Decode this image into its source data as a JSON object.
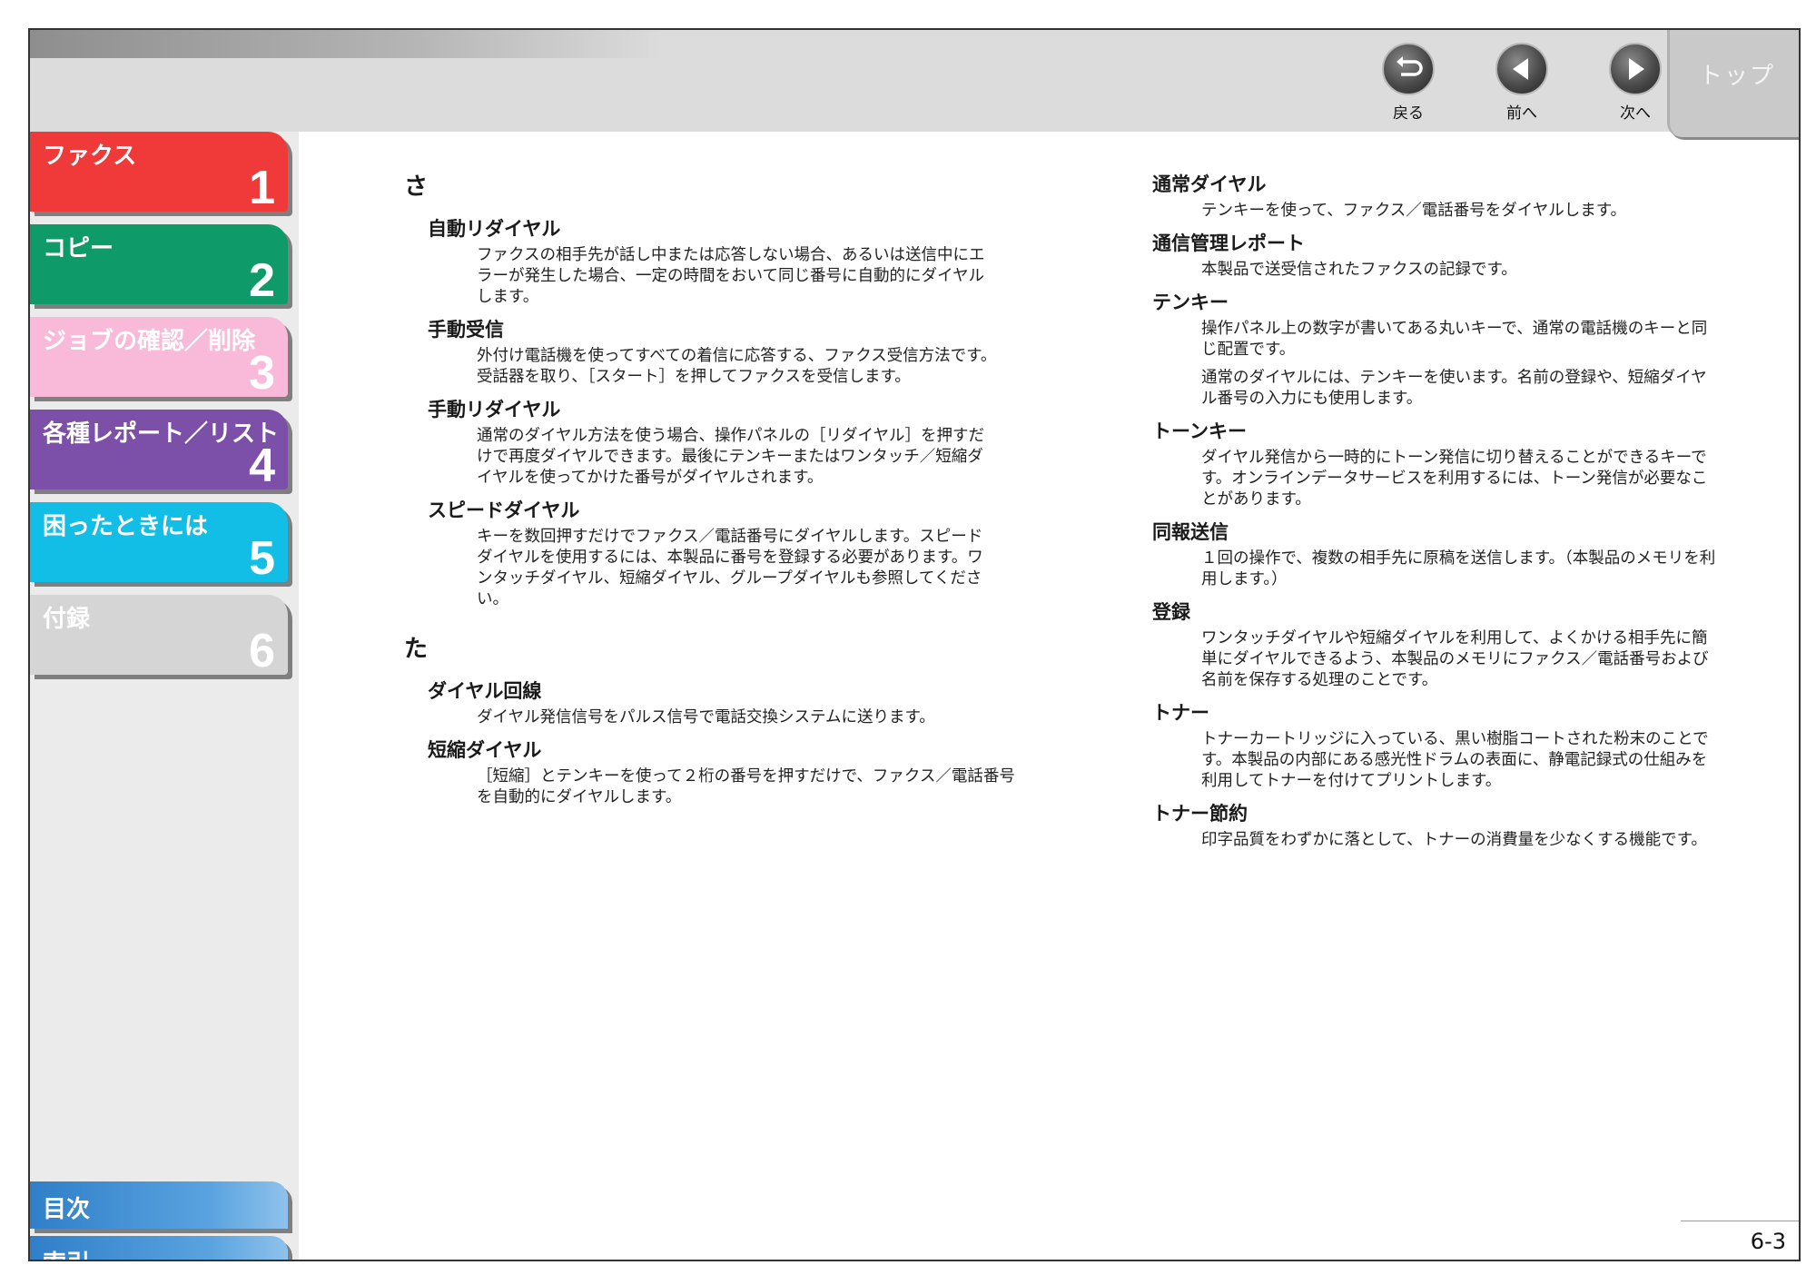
{
  "nav": {
    "back_label": "戻る",
    "prev_label": "前へ",
    "next_label": "次へ",
    "top_label": "トップ"
  },
  "sidebar": {
    "tabs": [
      {
        "label": "ファクス",
        "number": "1",
        "color": "#f03a3a"
      },
      {
        "label": "コピー",
        "number": "2",
        "color": "#0f9a6a"
      },
      {
        "label": "ジョブの確認／削除",
        "number": "3",
        "color": "#f9b9d8"
      },
      {
        "label": "各種レポート／リスト",
        "number": "4",
        "color": "#7c4fa9"
      },
      {
        "label": "困ったときには",
        "number": "5",
        "color": "#12bde6"
      },
      {
        "label": "付録",
        "number": "6",
        "color": "#d5d5d5"
      }
    ],
    "links": [
      {
        "label": "目次"
      },
      {
        "label": "索引"
      }
    ]
  },
  "left": {
    "sa": {
      "heading": "さ",
      "items": [
        {
          "term": "自動リダイヤル",
          "desc": [
            "ファクスの相手先が話し中または応答しない場合、あるいは送信中にエ",
            "ラーが発生した場合、一定の時間をおいて同じ番号に自動的にダイヤル",
            "します。"
          ]
        },
        {
          "term": "手動受信",
          "desc": [
            "外付け電話機を使ってすべての着信に応答する、ファクス受信方法です。",
            "受話器を取り、［スタート］を押してファクスを受信します。"
          ]
        },
        {
          "term": "手動リダイヤル",
          "desc": [
            "通常のダイヤル方法を使う場合、操作パネルの［リダイヤル］を押すだ",
            "けで再度ダイヤルできます。最後にテンキーまたはワンタッチ／短縮ダ",
            "イヤルを使ってかけた番号がダイヤルされます。"
          ]
        },
        {
          "term": "スピードダイヤル",
          "desc": [
            "キーを数回押すだけでファクス／電話番号にダイヤルします。スピード",
            "ダイヤルを使用するには、本製品に番号を登録する必要があります。ワ",
            "ンタッチダイヤル、短縮ダイヤル、グループダイヤルも参照してくださ",
            "い。"
          ]
        }
      ]
    },
    "ta": {
      "heading": "た",
      "items": [
        {
          "term": "ダイヤル回線",
          "desc": [
            "ダイヤル発信信号をパルス信号で電話交換システムに送ります。"
          ]
        },
        {
          "term": "短縮ダイヤル",
          "desc": [
            "［短縮］とテンキーを使って２桁の番号を押すだけで、ファクス／電話番号",
            "を自動的にダイヤルします。"
          ]
        }
      ]
    }
  },
  "right": {
    "items": [
      {
        "term": "通常ダイヤル",
        "paras": [
          [
            "テンキーを使って、ファクス／電話番号をダイヤルします。"
          ]
        ]
      },
      {
        "term": "通信管理レポート",
        "paras": [
          [
            "本製品で送受信されたファクスの記録です。"
          ]
        ]
      },
      {
        "term": "テンキー",
        "paras": [
          [
            "操作パネル上の数字が書いてある丸いキーで、通常の電話機のキーと同",
            "じ配置です。"
          ],
          [
            "通常のダイヤルには、テンキーを使います。名前の登録や、短縮ダイヤ",
            "ル番号の入力にも使用します。"
          ]
        ]
      },
      {
        "term": "トーンキー",
        "paras": [
          [
            "ダイヤル発信から一時的にトーン発信に切り替えることができるキーで",
            "す。オンラインデータサービスを利用するには、トーン発信が必要なこ",
            "とがあります。"
          ]
        ]
      },
      {
        "term": "同報送信",
        "paras": [
          [
            "１回の操作で、複数の相手先に原稿を送信します。（本製品のメモリを利",
            "用します。）"
          ]
        ]
      },
      {
        "term": "登録",
        "paras": [
          [
            "ワンタッチダイヤルや短縮ダイヤルを利用して、よくかける相手先に簡",
            "単にダイヤルできるよう、本製品のメモリにファクス／電話番号および",
            "名前を保存する処理のことです。"
          ]
        ]
      },
      {
        "term": "トナー",
        "paras": [
          [
            "トナーカートリッジに入っている、黒い樹脂コートされた粉末のことで",
            "す。本製品の内部にある感光性ドラムの表面に、静電記録式の仕組みを",
            "利用してトナーを付けてプリントします。"
          ]
        ]
      },
      {
        "term": "トナー節約",
        "paras": [
          [
            "印字品質をわずかに落として、トナーの消費量を少なくする機能です。"
          ]
        ]
      }
    ]
  },
  "page_number": "6-3"
}
